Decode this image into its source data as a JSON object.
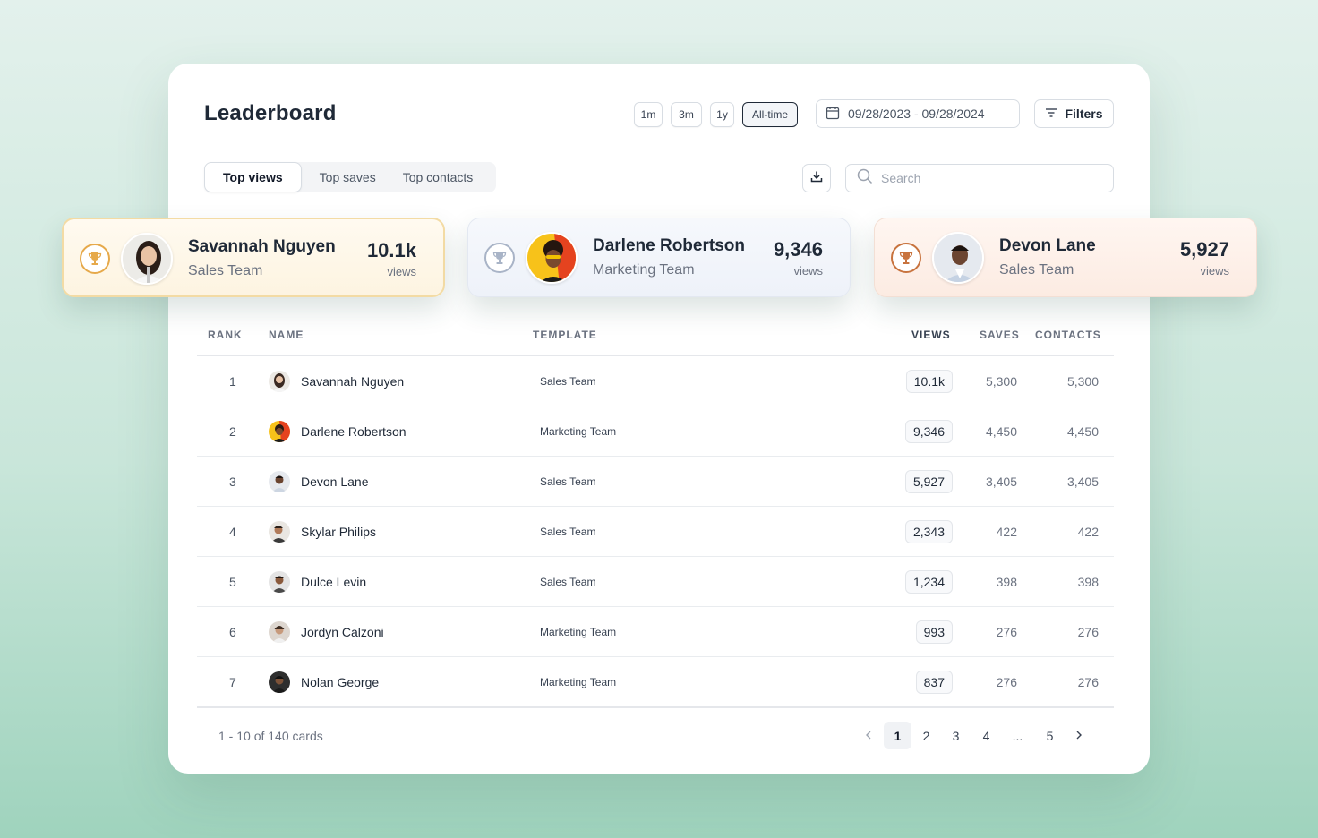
{
  "header": {
    "title": "Leaderboard",
    "periods": [
      "1m",
      "3m",
      "1y",
      "All-time"
    ],
    "active_period": "All-time",
    "date_range": "09/28/2023 - 09/28/2024",
    "filters_label": "Filters"
  },
  "tabs": [
    {
      "label": "Top views",
      "active": true
    },
    {
      "label": "Top saves",
      "active": false
    },
    {
      "label": "Top contacts",
      "active": false
    }
  ],
  "search": {
    "placeholder": "Search",
    "value": ""
  },
  "podium": [
    {
      "name": "Savannah Nguyen",
      "team": "Sales Team",
      "views": "10.1k",
      "unit": "views",
      "medal": "gold"
    },
    {
      "name": "Darlene Robertson",
      "team": "Marketing Team",
      "views": "9,346",
      "unit": "views",
      "medal": "silver"
    },
    {
      "name": "Devon Lane",
      "team": "Sales Team",
      "views": "5,927",
      "unit": "views",
      "medal": "bronze"
    }
  ],
  "table": {
    "columns": [
      "RANK",
      "NAME",
      "TEMPLATE",
      "VIEWS",
      "SAVES",
      "CONTACTS"
    ],
    "rows": [
      {
        "rank": "1",
        "name": "Savannah Nguyen",
        "template": "Sales Team",
        "views": "10.1k",
        "saves": "5,300",
        "contacts": "5,300"
      },
      {
        "rank": "2",
        "name": "Darlene Robertson",
        "template": "Marketing Team",
        "views": "9,346",
        "saves": "4,450",
        "contacts": "4,450"
      },
      {
        "rank": "3",
        "name": "Devon Lane",
        "template": "Sales Team",
        "views": "5,927",
        "saves": "3,405",
        "contacts": "3,405"
      },
      {
        "rank": "4",
        "name": "Skylar Philips",
        "template": "Sales Team",
        "views": "2,343",
        "saves": "422",
        "contacts": "422"
      },
      {
        "rank": "5",
        "name": "Dulce Levin",
        "template": "Sales Team",
        "views": "1,234",
        "saves": "398",
        "contacts": "398"
      },
      {
        "rank": "6",
        "name": "Jordyn Calzoni",
        "template": "Marketing Team",
        "views": "993",
        "saves": "276",
        "contacts": "276"
      },
      {
        "rank": "7",
        "name": "Nolan George",
        "template": "Marketing Team",
        "views": "837",
        "saves": "276",
        "contacts": "276"
      }
    ]
  },
  "footer": {
    "count_text": "1 - 10 of 140 cards",
    "pages": [
      "1",
      "2",
      "3",
      "4",
      "...",
      "5"
    ],
    "current_page": "1"
  },
  "colors": {
    "gold": "#e6a94a",
    "silver": "#a9b4c7",
    "bronze": "#c8733e"
  },
  "icons": [
    "calendar-icon",
    "filter-icon",
    "download-icon",
    "search-icon",
    "trophy-icon",
    "chevron-left-icon",
    "chevron-right-icon"
  ]
}
